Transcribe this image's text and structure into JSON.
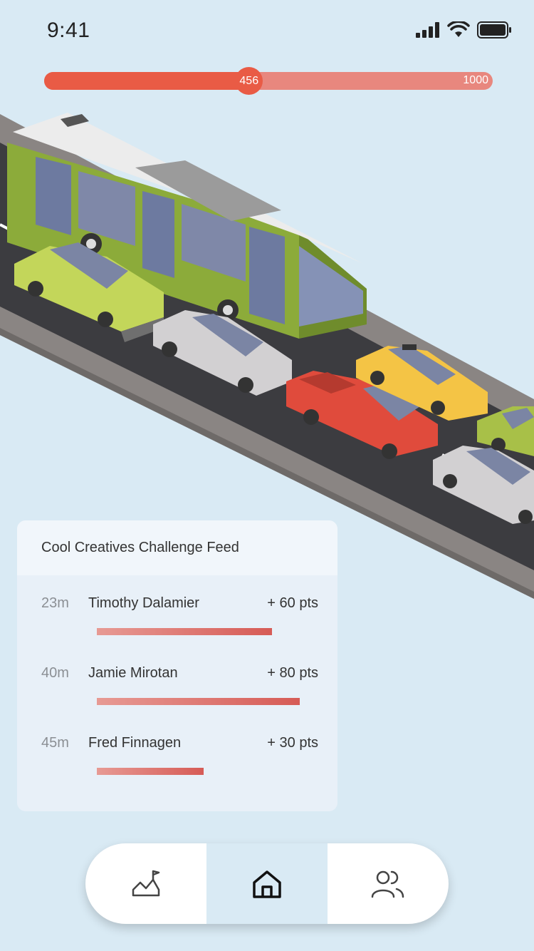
{
  "status_bar": {
    "time": "9:41"
  },
  "progress": {
    "current": "456",
    "max": "1000",
    "fraction": 0.456,
    "color_fill": "#e95b45",
    "color_track": "#e8877e"
  },
  "feed": {
    "title": "Cool Creatives Challenge Feed",
    "items": [
      {
        "time": "23m",
        "name": "Timothy Dalamier",
        "points": "+ 60 pts",
        "level": 0.77
      },
      {
        "time": "40m",
        "name": "Jamie Mirotan",
        "points": "+ 80 pts",
        "level": 0.89
      },
      {
        "time": "45m",
        "name": "Fred Finnagen",
        "points": "+ 30 pts",
        "level": 0.47
      }
    ]
  },
  "nav": {
    "items": [
      {
        "icon": "chart-icon",
        "active": false
      },
      {
        "icon": "home-icon",
        "active": true
      },
      {
        "icon": "users-icon",
        "active": false
      }
    ]
  },
  "colors": {
    "background": "#d9eaf4",
    "accent": "#e95b45"
  }
}
